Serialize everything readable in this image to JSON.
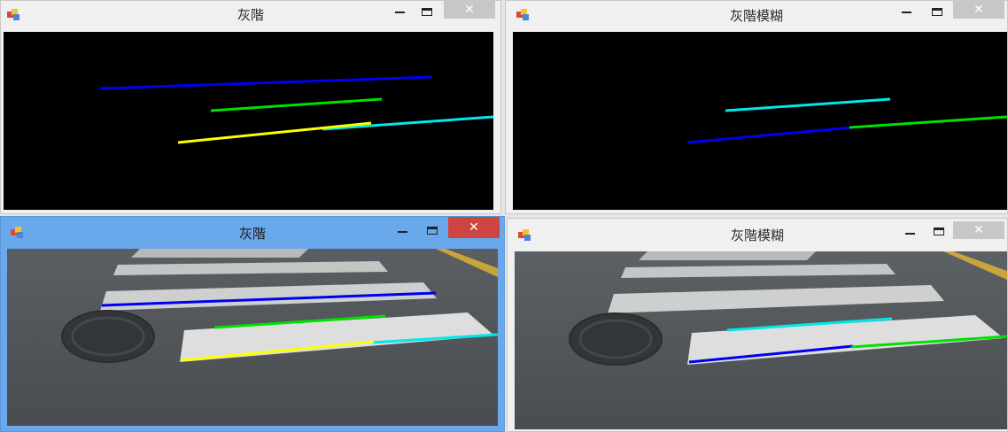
{
  "windows": {
    "top_left": {
      "title": "灰階"
    },
    "top_right": {
      "title": "灰階模糊"
    },
    "bottom_left": {
      "title": "灰階"
    },
    "bottom_right": {
      "title": "灰階模糊"
    }
  },
  "controls": {
    "minimize": "minimize-icon",
    "maximize": "maximize-icon",
    "close": "close-icon",
    "close_glyph": "✕"
  },
  "colors": {
    "blue": "#0000ee",
    "green": "#00e000",
    "yellow": "#ffff00",
    "cyan": "#00e8e8",
    "active_frame": "#6aa8ec",
    "active_close": "#cd4540"
  }
}
